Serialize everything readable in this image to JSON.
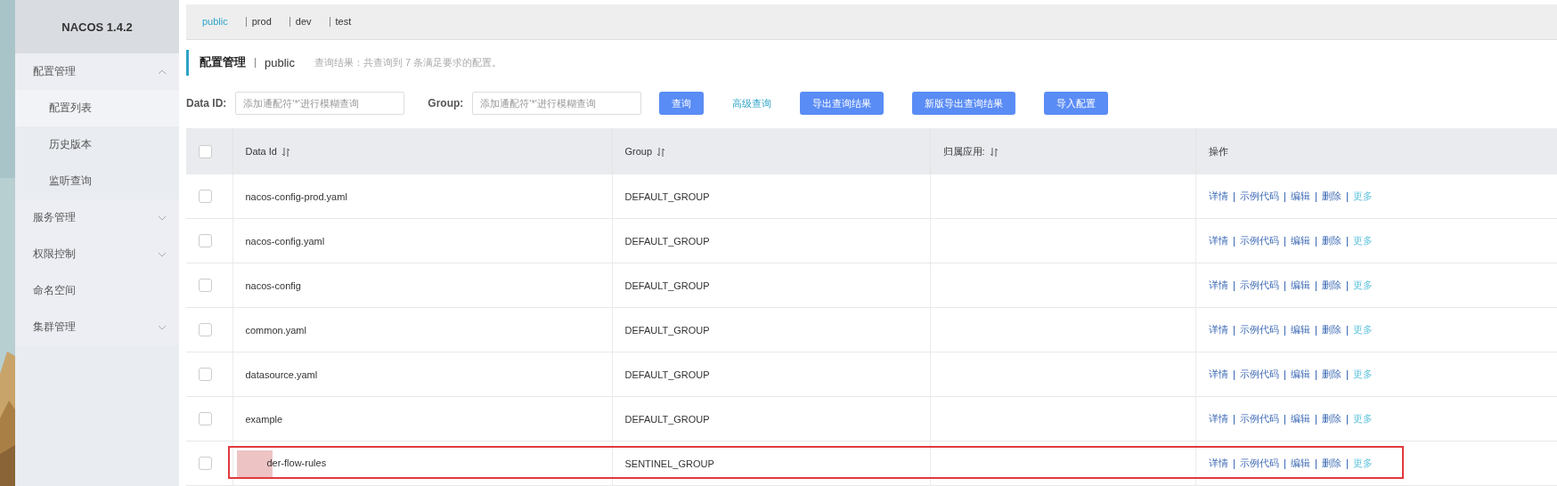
{
  "sidebar": {
    "title": "NACOS 1.4.2",
    "items": [
      {
        "label": "配置管理",
        "expanded": true,
        "children": [
          {
            "label": "配置列表",
            "selected": true
          },
          {
            "label": "历史版本",
            "selected": false
          },
          {
            "label": "监听查询",
            "selected": false
          }
        ]
      },
      {
        "label": "服务管理",
        "expanded": false
      },
      {
        "label": "权限控制",
        "expanded": false
      },
      {
        "label": "命名空间"
      },
      {
        "label": "集群管理",
        "expanded": false
      }
    ]
  },
  "namespaces": [
    {
      "label": "public",
      "selected": true
    },
    {
      "label": "prod",
      "selected": false
    },
    {
      "label": "dev",
      "selected": false
    },
    {
      "label": "test",
      "selected": false
    }
  ],
  "page_header": {
    "title": "配置管理",
    "namespace": "public",
    "result": "查询结果：共查询到 7 条满足要求的配置。"
  },
  "search": {
    "data_id": {
      "label": "Data ID:",
      "placeholder": "添加通配符'*'进行模糊查询"
    },
    "group": {
      "label": "Group:",
      "placeholder": "添加通配符'*'进行模糊查询"
    },
    "query_button": "查询",
    "advanced_link": "高级查询",
    "buttons": [
      "导出查询结果",
      "新版导出查询结果",
      "导入配置"
    ]
  },
  "table": {
    "all_checked": false,
    "columns": [
      {
        "label": "Data Id",
        "sortable": true
      },
      {
        "label": "Group",
        "sortable": true
      },
      {
        "label": "归属应用:",
        "sortable": true
      },
      {
        "label": "操作",
        "sortable": false
      }
    ],
    "rows": [
      {
        "data_id": "nacos-config-prod.yaml",
        "group": "DEFAULT_GROUP",
        "checked": false,
        "highlighted": false,
        "actions": [
          {
            "label": "详情",
            "kind": "link"
          },
          {
            "label": "示例代码",
            "kind": "link"
          },
          {
            "label": "编辑",
            "kind": "link"
          },
          {
            "label": "删除",
            "kind": "link"
          },
          {
            "label": "更多",
            "kind": "more"
          }
        ]
      },
      {
        "data_id": "nacos-config.yaml",
        "group": "DEFAULT_GROUP",
        "checked": false,
        "highlighted": false,
        "actions": [
          {
            "label": "详情",
            "kind": "link"
          },
          {
            "label": "示例代码",
            "kind": "link"
          },
          {
            "label": "编辑",
            "kind": "link"
          },
          {
            "label": "删除",
            "kind": "link"
          },
          {
            "label": "更多",
            "kind": "more"
          }
        ]
      },
      {
        "data_id": "nacos-config",
        "group": "DEFAULT_GROUP",
        "checked": false,
        "highlighted": false,
        "actions": [
          {
            "label": "详情",
            "kind": "link"
          },
          {
            "label": "示例代码",
            "kind": "link"
          },
          {
            "label": "编辑",
            "kind": "link"
          },
          {
            "label": "删除",
            "kind": "link"
          },
          {
            "label": "更多",
            "kind": "more"
          }
        ]
      },
      {
        "data_id": "common.yaml",
        "group": "DEFAULT_GROUP",
        "checked": false,
        "highlighted": false,
        "actions": [
          {
            "label": "详情",
            "kind": "link"
          },
          {
            "label": "示例代码",
            "kind": "link"
          },
          {
            "label": "编辑",
            "kind": "link"
          },
          {
            "label": "删除",
            "kind": "link"
          },
          {
            "label": "更多",
            "kind": "more"
          }
        ]
      },
      {
        "data_id": "datasource.yaml",
        "group": "DEFAULT_GROUP",
        "checked": false,
        "highlighted": false,
        "actions": [
          {
            "label": "详情",
            "kind": "link"
          },
          {
            "label": "示例代码",
            "kind": "link"
          },
          {
            "label": "编辑",
            "kind": "link"
          },
          {
            "label": "删除",
            "kind": "link"
          },
          {
            "label": "更多",
            "kind": "more"
          }
        ]
      },
      {
        "data_id": "example",
        "group": "DEFAULT_GROUP",
        "checked": false,
        "highlighted": false,
        "actions": [
          {
            "label": "详情",
            "kind": "link"
          },
          {
            "label": "示例代码",
            "kind": "link"
          },
          {
            "label": "编辑",
            "kind": "link"
          },
          {
            "label": "删除",
            "kind": "link"
          },
          {
            "label": "更多",
            "kind": "more"
          }
        ]
      },
      {
        "data_id": "der-flow-rules",
        "group": "SENTINEL_GROUP",
        "checked": false,
        "highlighted": true,
        "redacted": true,
        "actions": [
          {
            "label": "详情",
            "kind": "link"
          },
          {
            "label": "示例代码",
            "kind": "link"
          },
          {
            "label": "编辑",
            "kind": "link"
          },
          {
            "label": "删除",
            "kind": "link"
          },
          {
            "label": "更多",
            "kind": "more"
          }
        ]
      }
    ]
  }
}
